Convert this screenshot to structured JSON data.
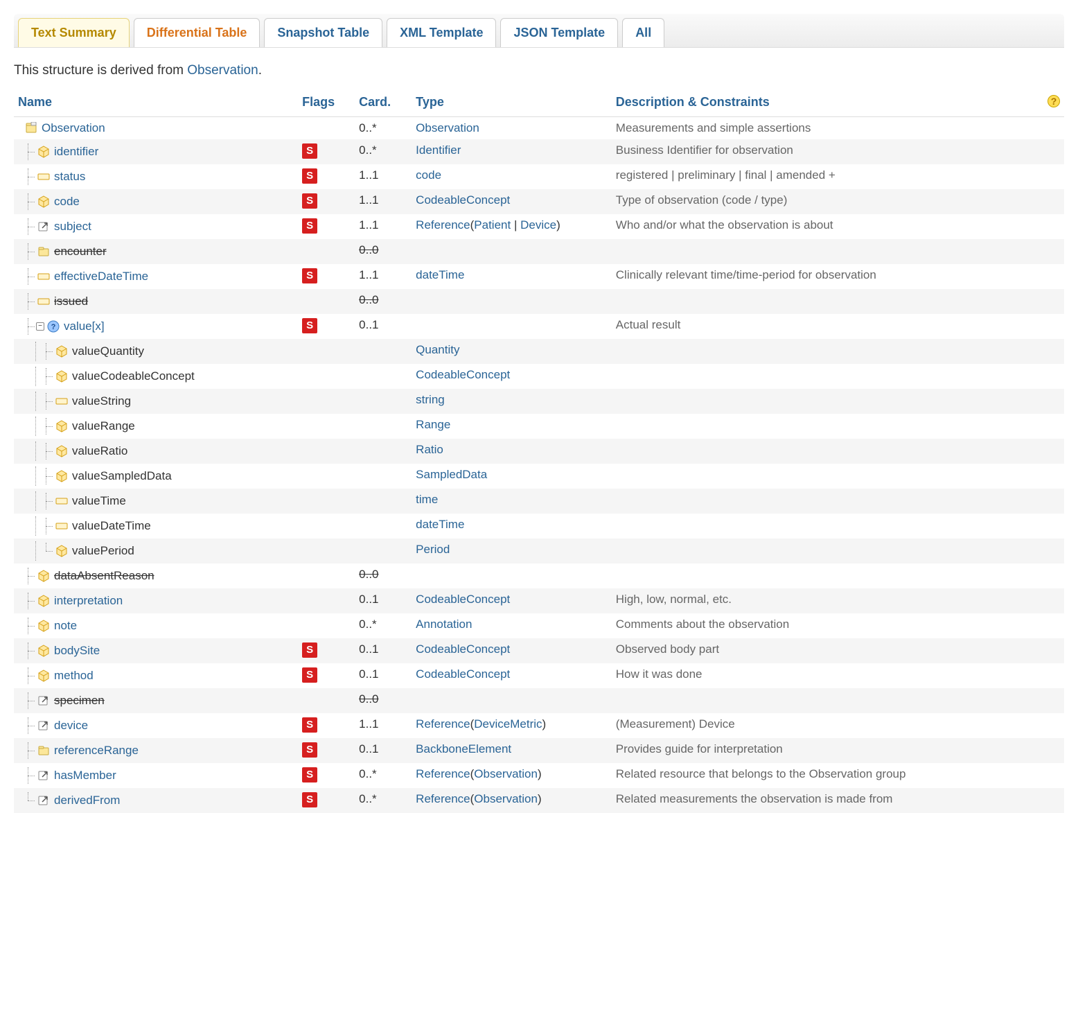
{
  "tabs": [
    "Text Summary",
    "Differential Table",
    "Snapshot Table",
    "XML Template",
    "JSON Template",
    "All"
  ],
  "activeTabYellow": 0,
  "activeTabOrange": 1,
  "intro_prefix": "This structure is derived from ",
  "intro_link": "Observation",
  "intro_suffix": ".",
  "headers": {
    "name": "Name",
    "flags": "Flags",
    "card": "Card.",
    "type": "Type",
    "desc": "Description & Constraints"
  },
  "help_tooltip": "?",
  "rows": [
    {
      "indent": 0,
      "icon": "resource",
      "name": "Observation",
      "nameClass": "link",
      "flag": "",
      "card": "0..*",
      "type": [
        {
          "t": "Observation",
          "l": 1
        }
      ],
      "desc": "Measurements and simple assertions"
    },
    {
      "indent": 1,
      "icon": "datatype",
      "name": "identifier",
      "nameClass": "link",
      "flag": "S",
      "card": "0..*",
      "type": [
        {
          "t": "Identifier",
          "l": 1
        }
      ],
      "desc": "Business Identifier for observation"
    },
    {
      "indent": 1,
      "icon": "primitive",
      "name": "status",
      "nameClass": "link",
      "flag": "S",
      "card": "1..1",
      "type": [
        {
          "t": "code",
          "l": 1
        }
      ],
      "desc": "registered | preliminary | final | amended +"
    },
    {
      "indent": 1,
      "icon": "datatype",
      "name": "code",
      "nameClass": "link",
      "flag": "S",
      "card": "1..1",
      "type": [
        {
          "t": "CodeableConcept",
          "l": 1
        }
      ],
      "desc": "Type of observation (code / type)"
    },
    {
      "indent": 1,
      "icon": "reference",
      "name": "subject",
      "nameClass": "link",
      "flag": "S",
      "card": "1..1",
      "type": [
        {
          "t": "Reference",
          "l": 1
        },
        {
          "t": "(",
          "l": 0
        },
        {
          "t": "Patient",
          "l": 1
        },
        {
          "t": " | ",
          "l": 0
        },
        {
          "t": "Device",
          "l": 1
        },
        {
          "t": ")",
          "l": 0
        }
      ],
      "desc": "Who and/or what the observation is about"
    },
    {
      "indent": 1,
      "icon": "element",
      "name": "encounter",
      "nameClass": "strike",
      "flag": "",
      "card": "0..0",
      "cardStrike": true,
      "type": [],
      "desc": ""
    },
    {
      "indent": 1,
      "icon": "primitive",
      "name": "effectiveDateTime",
      "nameClass": "link",
      "flag": "S",
      "card": "1..1",
      "type": [
        {
          "t": "dateTime",
          "l": 1
        }
      ],
      "desc": "Clinically relevant time/time-period for observation"
    },
    {
      "indent": 1,
      "icon": "primitive",
      "name": "issued",
      "nameClass": "strike",
      "flag": "",
      "card": "0..0",
      "cardStrike": true,
      "type": [],
      "desc": ""
    },
    {
      "indent": 1,
      "icon": "choice",
      "name": "value[x]",
      "nameClass": "link",
      "flag": "S",
      "card": "0..1",
      "type": [],
      "desc": "Actual result",
      "expandable": true
    },
    {
      "indent": 2,
      "icon": "datatype",
      "name": "valueQuantity",
      "nameClass": "plain",
      "flag": "",
      "card": "",
      "type": [
        {
          "t": "Quantity",
          "l": 1
        }
      ],
      "desc": ""
    },
    {
      "indent": 2,
      "icon": "datatype",
      "name": "valueCodeableConcept",
      "nameClass": "plain",
      "flag": "",
      "card": "",
      "type": [
        {
          "t": "CodeableConcept",
          "l": 1
        }
      ],
      "desc": ""
    },
    {
      "indent": 2,
      "icon": "primitive",
      "name": "valueString",
      "nameClass": "plain",
      "flag": "",
      "card": "",
      "type": [
        {
          "t": "string",
          "l": 1
        }
      ],
      "desc": ""
    },
    {
      "indent": 2,
      "icon": "datatype",
      "name": "valueRange",
      "nameClass": "plain",
      "flag": "",
      "card": "",
      "type": [
        {
          "t": "Range",
          "l": 1
        }
      ],
      "desc": ""
    },
    {
      "indent": 2,
      "icon": "datatype",
      "name": "valueRatio",
      "nameClass": "plain",
      "flag": "",
      "card": "",
      "type": [
        {
          "t": "Ratio",
          "l": 1
        }
      ],
      "desc": ""
    },
    {
      "indent": 2,
      "icon": "datatype",
      "name": "valueSampledData",
      "nameClass": "plain",
      "flag": "",
      "card": "",
      "type": [
        {
          "t": "SampledData",
          "l": 1
        }
      ],
      "desc": ""
    },
    {
      "indent": 2,
      "icon": "primitive",
      "name": "valueTime",
      "nameClass": "plain",
      "flag": "",
      "card": "",
      "type": [
        {
          "t": "time",
          "l": 1
        }
      ],
      "desc": ""
    },
    {
      "indent": 2,
      "icon": "primitive",
      "name": "valueDateTime",
      "nameClass": "plain",
      "flag": "",
      "card": "",
      "type": [
        {
          "t": "dateTime",
          "l": 1
        }
      ],
      "desc": ""
    },
    {
      "indent": 2,
      "icon": "datatype",
      "name": "valuePeriod",
      "nameClass": "plain",
      "flag": "",
      "card": "",
      "type": [
        {
          "t": "Period",
          "l": 1
        }
      ],
      "desc": "",
      "last": true
    },
    {
      "indent": 1,
      "icon": "datatype",
      "name": "dataAbsentReason",
      "nameClass": "strike",
      "flag": "",
      "card": "0..0",
      "cardStrike": true,
      "type": [],
      "desc": ""
    },
    {
      "indent": 1,
      "icon": "datatype",
      "name": "interpretation",
      "nameClass": "link",
      "flag": "",
      "card": "0..1",
      "type": [
        {
          "t": "CodeableConcept",
          "l": 1
        }
      ],
      "desc": "High, low, normal, etc."
    },
    {
      "indent": 1,
      "icon": "datatype",
      "name": "note",
      "nameClass": "link",
      "flag": "",
      "card": "0..*",
      "type": [
        {
          "t": "Annotation",
          "l": 1
        }
      ],
      "desc": "Comments about the observation"
    },
    {
      "indent": 1,
      "icon": "datatype",
      "name": "bodySite",
      "nameClass": "link",
      "flag": "S",
      "card": "0..1",
      "type": [
        {
          "t": "CodeableConcept",
          "l": 1
        }
      ],
      "desc": "Observed body part"
    },
    {
      "indent": 1,
      "icon": "datatype",
      "name": "method",
      "nameClass": "link",
      "flag": "S",
      "card": "0..1",
      "type": [
        {
          "t": "CodeableConcept",
          "l": 1
        }
      ],
      "desc": "How it was done"
    },
    {
      "indent": 1,
      "icon": "reference",
      "name": "specimen",
      "nameClass": "strike",
      "flag": "",
      "card": "0..0",
      "cardStrike": true,
      "type": [],
      "desc": ""
    },
    {
      "indent": 1,
      "icon": "reference",
      "name": "device",
      "nameClass": "link",
      "flag": "S",
      "card": "1..1",
      "type": [
        {
          "t": "Reference",
          "l": 1
        },
        {
          "t": "(",
          "l": 0
        },
        {
          "t": "DeviceMetric",
          "l": 1
        },
        {
          "t": ")",
          "l": 0
        }
      ],
      "desc": "(Measurement) Device"
    },
    {
      "indent": 1,
      "icon": "element",
      "name": "referenceRange",
      "nameClass": "link",
      "flag": "S",
      "card": "0..1",
      "type": [
        {
          "t": "BackboneElement",
          "l": 2
        }
      ],
      "desc": "Provides guide for interpretation"
    },
    {
      "indent": 1,
      "icon": "reference",
      "name": "hasMember",
      "nameClass": "link",
      "flag": "S",
      "card": "0..*",
      "type": [
        {
          "t": "Reference",
          "l": 1
        },
        {
          "t": "(",
          "l": 0
        },
        {
          "t": "Observation",
          "l": 1
        },
        {
          "t": ")",
          "l": 0
        }
      ],
      "desc": "Related resource that belongs to the Observation group"
    },
    {
      "indent": 1,
      "icon": "reference",
      "name": "derivedFrom",
      "nameClass": "link",
      "flag": "S",
      "card": "0..*",
      "type": [
        {
          "t": "Reference",
          "l": 1
        },
        {
          "t": "(",
          "l": 0
        },
        {
          "t": "Observation",
          "l": 1
        },
        {
          "t": ")",
          "l": 0
        }
      ],
      "desc": "Related measurements the observation is made from",
      "last": true
    }
  ]
}
